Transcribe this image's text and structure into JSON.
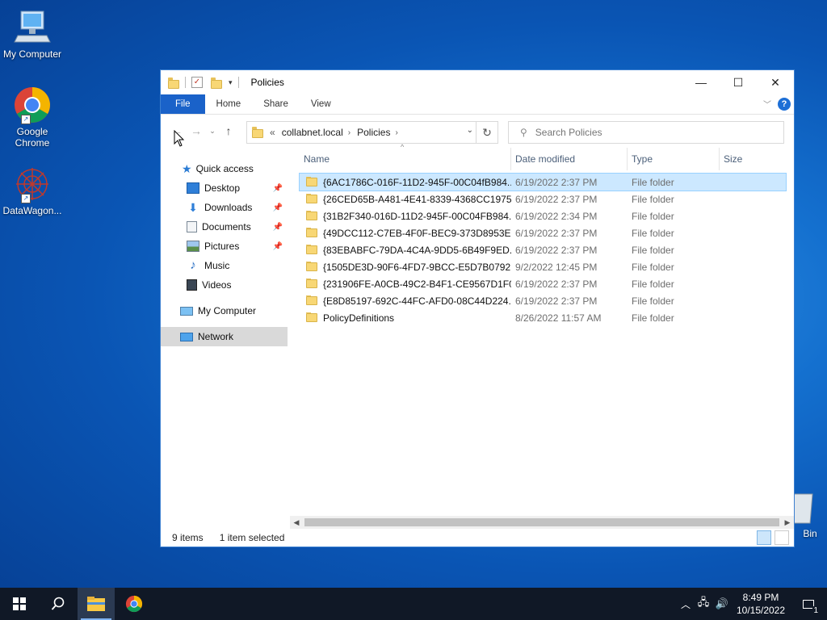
{
  "desktop": {
    "icons": [
      {
        "label": "My Computer",
        "icon": "computer-icon"
      },
      {
        "label": "Google Chrome",
        "icon": "chrome-icon"
      },
      {
        "label": "DataWagon...",
        "icon": "datawagon-icon"
      },
      {
        "label": "Bin",
        "icon": "recycle-bin-icon"
      }
    ]
  },
  "window": {
    "title": "Policies",
    "controls": {
      "minimize": "—",
      "maximize": "☐",
      "close": "✕"
    },
    "ribbon_tabs": [
      "File",
      "Home",
      "Share",
      "View"
    ],
    "help": "?",
    "address": {
      "overflow": "«",
      "crumbs": [
        "collabnet.local",
        "Policies"
      ]
    },
    "search": {
      "placeholder": "Search Policies"
    },
    "nav": {
      "quick_access": "Quick access",
      "pinned": [
        {
          "label": "Desktop",
          "icon": "desktop-icon"
        },
        {
          "label": "Downloads",
          "icon": "downloads-icon"
        },
        {
          "label": "Documents",
          "icon": "documents-icon"
        },
        {
          "label": "Pictures",
          "icon": "pictures-icon"
        }
      ],
      "unpinned": [
        {
          "label": "Music",
          "icon": "music-icon"
        },
        {
          "label": "Videos",
          "icon": "videos-icon"
        }
      ],
      "my_computer": "My Computer",
      "network": "Network"
    },
    "columns": {
      "name": "Name",
      "date": "Date modified",
      "type": "Type",
      "size": "Size"
    },
    "rows": [
      {
        "name": "{6AC1786C-016F-11D2-945F-00C04fB984...",
        "date": "6/19/2022 2:37 PM",
        "type": "File folder",
        "size": "",
        "selected": true
      },
      {
        "name": "{26CED65B-A481-4E41-8339-4368CC1975...",
        "date": "6/19/2022 2:37 PM",
        "type": "File folder",
        "size": ""
      },
      {
        "name": "{31B2F340-016D-11D2-945F-00C04FB984...",
        "date": "6/19/2022 2:34 PM",
        "type": "File folder",
        "size": ""
      },
      {
        "name": "{49DCC112-C7EB-4F0F-BEC9-373D8953E...",
        "date": "6/19/2022 2:37 PM",
        "type": "File folder",
        "size": ""
      },
      {
        "name": "{83EBABFC-79DA-4C4A-9DD5-6B49F9ED...",
        "date": "6/19/2022 2:37 PM",
        "type": "File folder",
        "size": ""
      },
      {
        "name": "{1505DE3D-90F6-4FD7-9BCC-E5D7B0792...",
        "date": "9/2/2022 12:45 PM",
        "type": "File folder",
        "size": ""
      },
      {
        "name": "{231906FE-A0CB-49C2-B4F1-CE9567D1F0...",
        "date": "6/19/2022 2:37 PM",
        "type": "File folder",
        "size": ""
      },
      {
        "name": "{E8D85197-692C-44FC-AFD0-08C44D224...",
        "date": "6/19/2022 2:37 PM",
        "type": "File folder",
        "size": ""
      },
      {
        "name": "PolicyDefinitions",
        "date": "8/26/2022 11:57 AM",
        "type": "File folder",
        "size": ""
      }
    ],
    "status": {
      "items": "9 items",
      "selected": "1 item selected"
    }
  },
  "taskbar": {
    "clock_time": "8:49 PM",
    "clock_date": "10/15/2022",
    "notification_count": "1"
  },
  "colors": {
    "accent": "#1a62c9",
    "selection": "#cce8ff",
    "taskbar": "#101826"
  }
}
